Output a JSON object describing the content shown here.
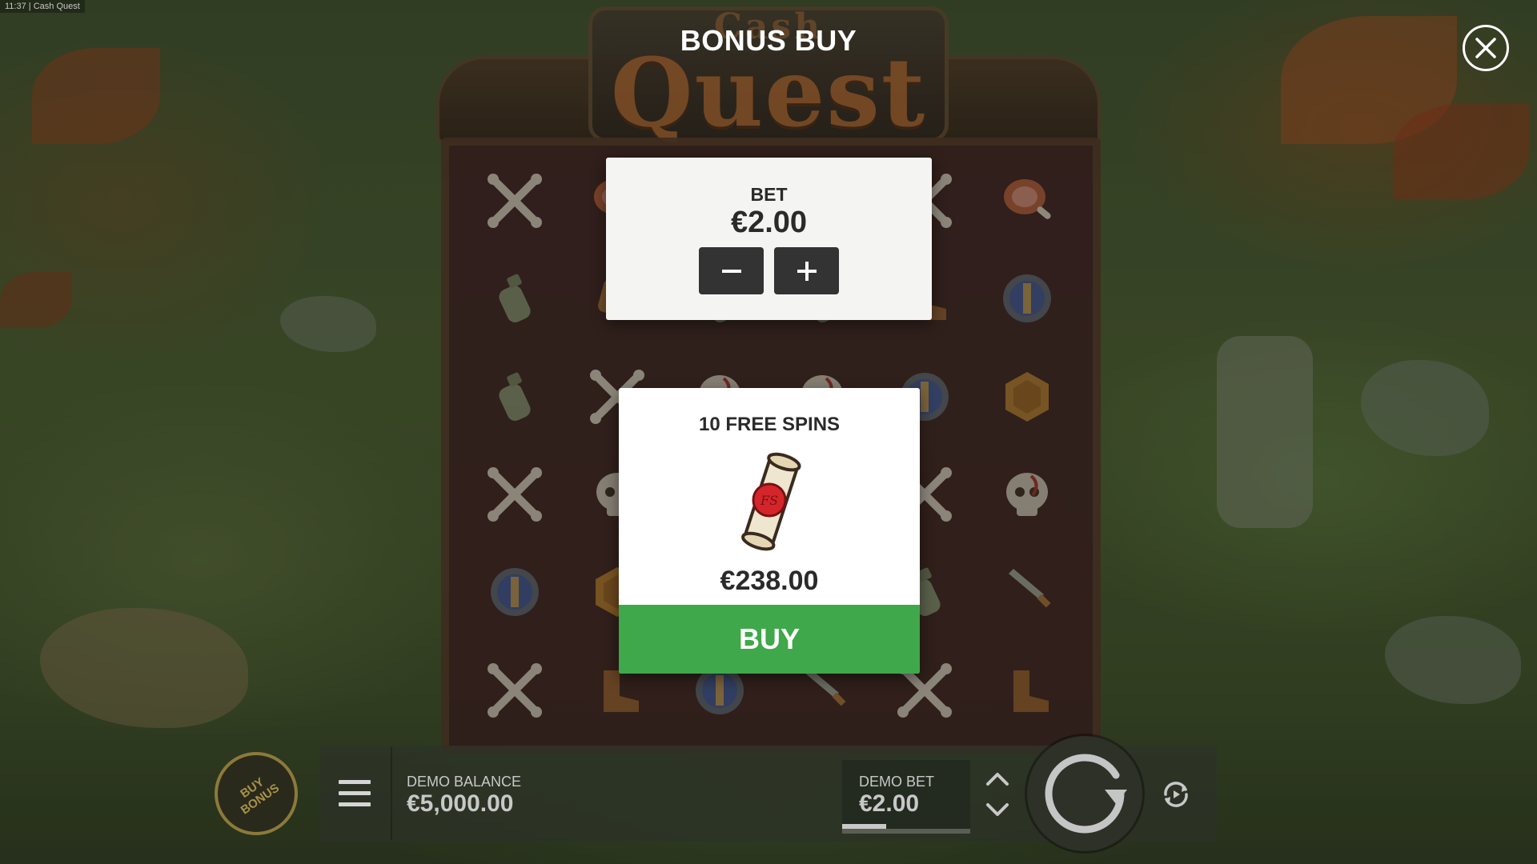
{
  "status_bar": {
    "time": "11:37",
    "separator": "|",
    "app_title": "Cash Quest"
  },
  "logo": {
    "top_word": "Cash",
    "main_word": "Quest"
  },
  "modal": {
    "title": "BONUS BUY",
    "close_icon": "close-icon",
    "bet": {
      "label": "BET",
      "value": "€2.00",
      "decrease_icon": "minus-icon",
      "increase_icon": "plus-icon"
    },
    "offer": {
      "title": "10 FREE SPINS",
      "icon": "scroll-icon",
      "price": "€238.00",
      "buy_label": "BUY"
    }
  },
  "hud": {
    "buy_bonus_label": "BUY BONUS",
    "menu_icon": "menu-icon",
    "balance_label": "DEMO BALANCE",
    "balance_value": "€5,000.00",
    "bet_label": "DEMO BET",
    "bet_value": "€2.00",
    "bet_up_icon": "chevron-up-icon",
    "bet_down_icon": "chevron-down-icon",
    "spin_icon": "spin-icon",
    "autoplay_icon": "autoplay-icon"
  },
  "reels": [
    [
      "bones",
      "ham",
      "pumpkin",
      "pumpkin",
      "bones",
      "ham"
    ],
    [
      "potion",
      "badge",
      "potion",
      "potion",
      "boot",
      "shield"
    ],
    [
      "potion",
      "bones",
      "skull",
      "skull",
      "shield",
      "coin"
    ],
    [
      "bones",
      "skull",
      "skull",
      "bones",
      "bones",
      "skull"
    ],
    [
      "shield",
      "coin",
      "dagger",
      "potion",
      "potion",
      "dagger"
    ],
    [
      "bones",
      "boot",
      "shield",
      "dagger",
      "bones",
      "boot"
    ]
  ],
  "colors": {
    "accent_green": "#3fa84a",
    "card_bg": "#f4f4f2",
    "button_dark": "#333333",
    "reel_bg": "#3a1f1f",
    "logo_orange": "#a4602e"
  }
}
